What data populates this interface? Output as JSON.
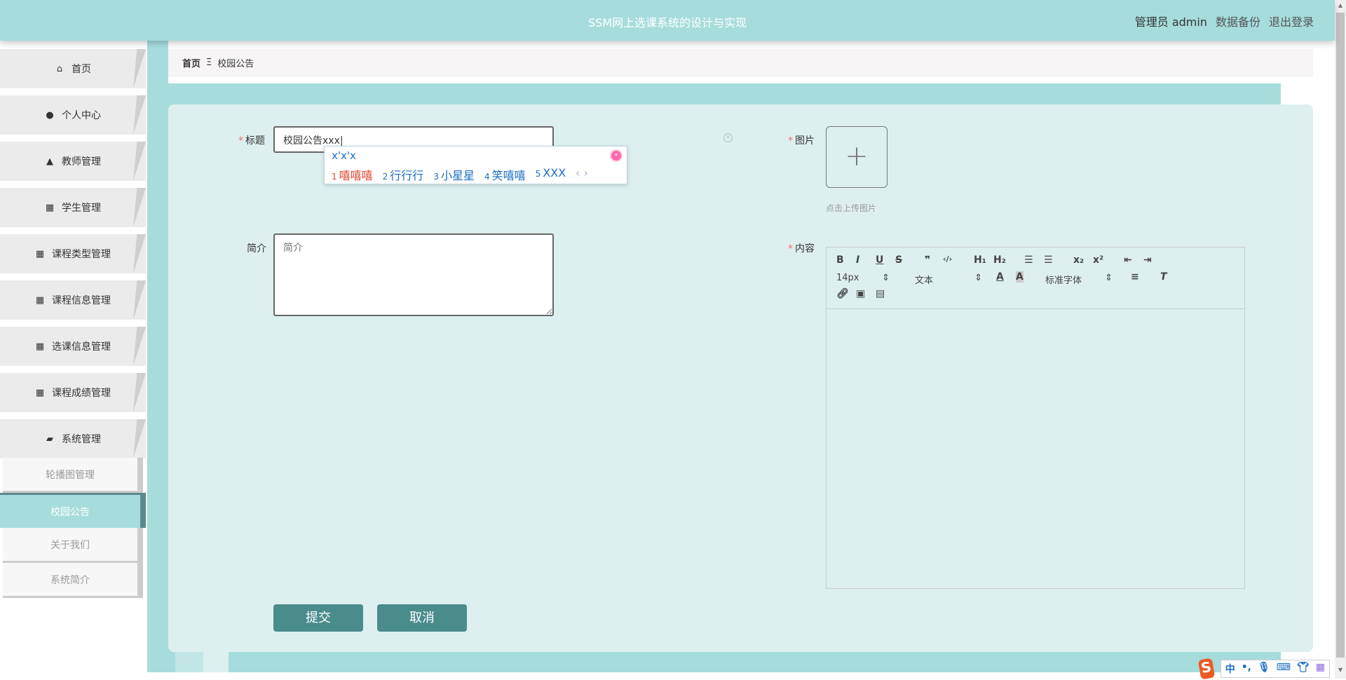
{
  "header": {
    "title": "SSM网上选课系统的设计与实现",
    "user": "管理员 admin",
    "backup": "数据备份",
    "logout": "退出登录"
  },
  "sidebar": {
    "items": [
      {
        "label": "首页",
        "icon": "home-icon",
        "glyph": "⌂"
      },
      {
        "label": "个人中心",
        "icon": "user-icon",
        "glyph": "●"
      },
      {
        "label": "教师管理",
        "icon": "teacher-icon",
        "glyph": "▲"
      },
      {
        "label": "学生管理",
        "icon": "grid-icon",
        "glyph": "▦"
      },
      {
        "label": "课程类型管理",
        "icon": "grid-icon",
        "glyph": "▦"
      },
      {
        "label": "课程信息管理",
        "icon": "grid-icon",
        "glyph": "▦"
      },
      {
        "label": "选课信息管理",
        "icon": "grid-icon",
        "glyph": "▦"
      },
      {
        "label": "课程成绩管理",
        "icon": "grid-icon",
        "glyph": "▦"
      },
      {
        "label": "系统管理",
        "icon": "wallet-icon",
        "glyph": "▰"
      }
    ],
    "sub": [
      "轮播图管理",
      "校园公告",
      "关于我们",
      "系统简介"
    ]
  },
  "breadcrumb": {
    "home": "首页",
    "sep": "Ξ",
    "current": "校园公告"
  },
  "form": {
    "title_label": "标题",
    "title_value": "校园公告xxx",
    "image_label": "图片",
    "upload_plus": "+",
    "upload_tip": "点击上传图片",
    "intro_label": "简介",
    "intro_placeholder": "简介",
    "content_label": "内容",
    "submit": "提交",
    "cancel": "取消"
  },
  "ime": {
    "composition": "x'x'x",
    "candidates": [
      {
        "n": "1",
        "t": "嘻嘻嘻"
      },
      {
        "n": "2",
        "t": "行行行"
      },
      {
        "n": "3",
        "t": "小星星"
      },
      {
        "n": "4",
        "t": "笑嘻嘻"
      },
      {
        "n": "5",
        "t": "XXX"
      }
    ],
    "nav": "‹ ›"
  },
  "editor": {
    "font_size": "14px",
    "text_type": "文本",
    "font_family": "标准字体"
  },
  "imebar": {
    "logo": "S",
    "mode": "中",
    "punct": "•,"
  }
}
